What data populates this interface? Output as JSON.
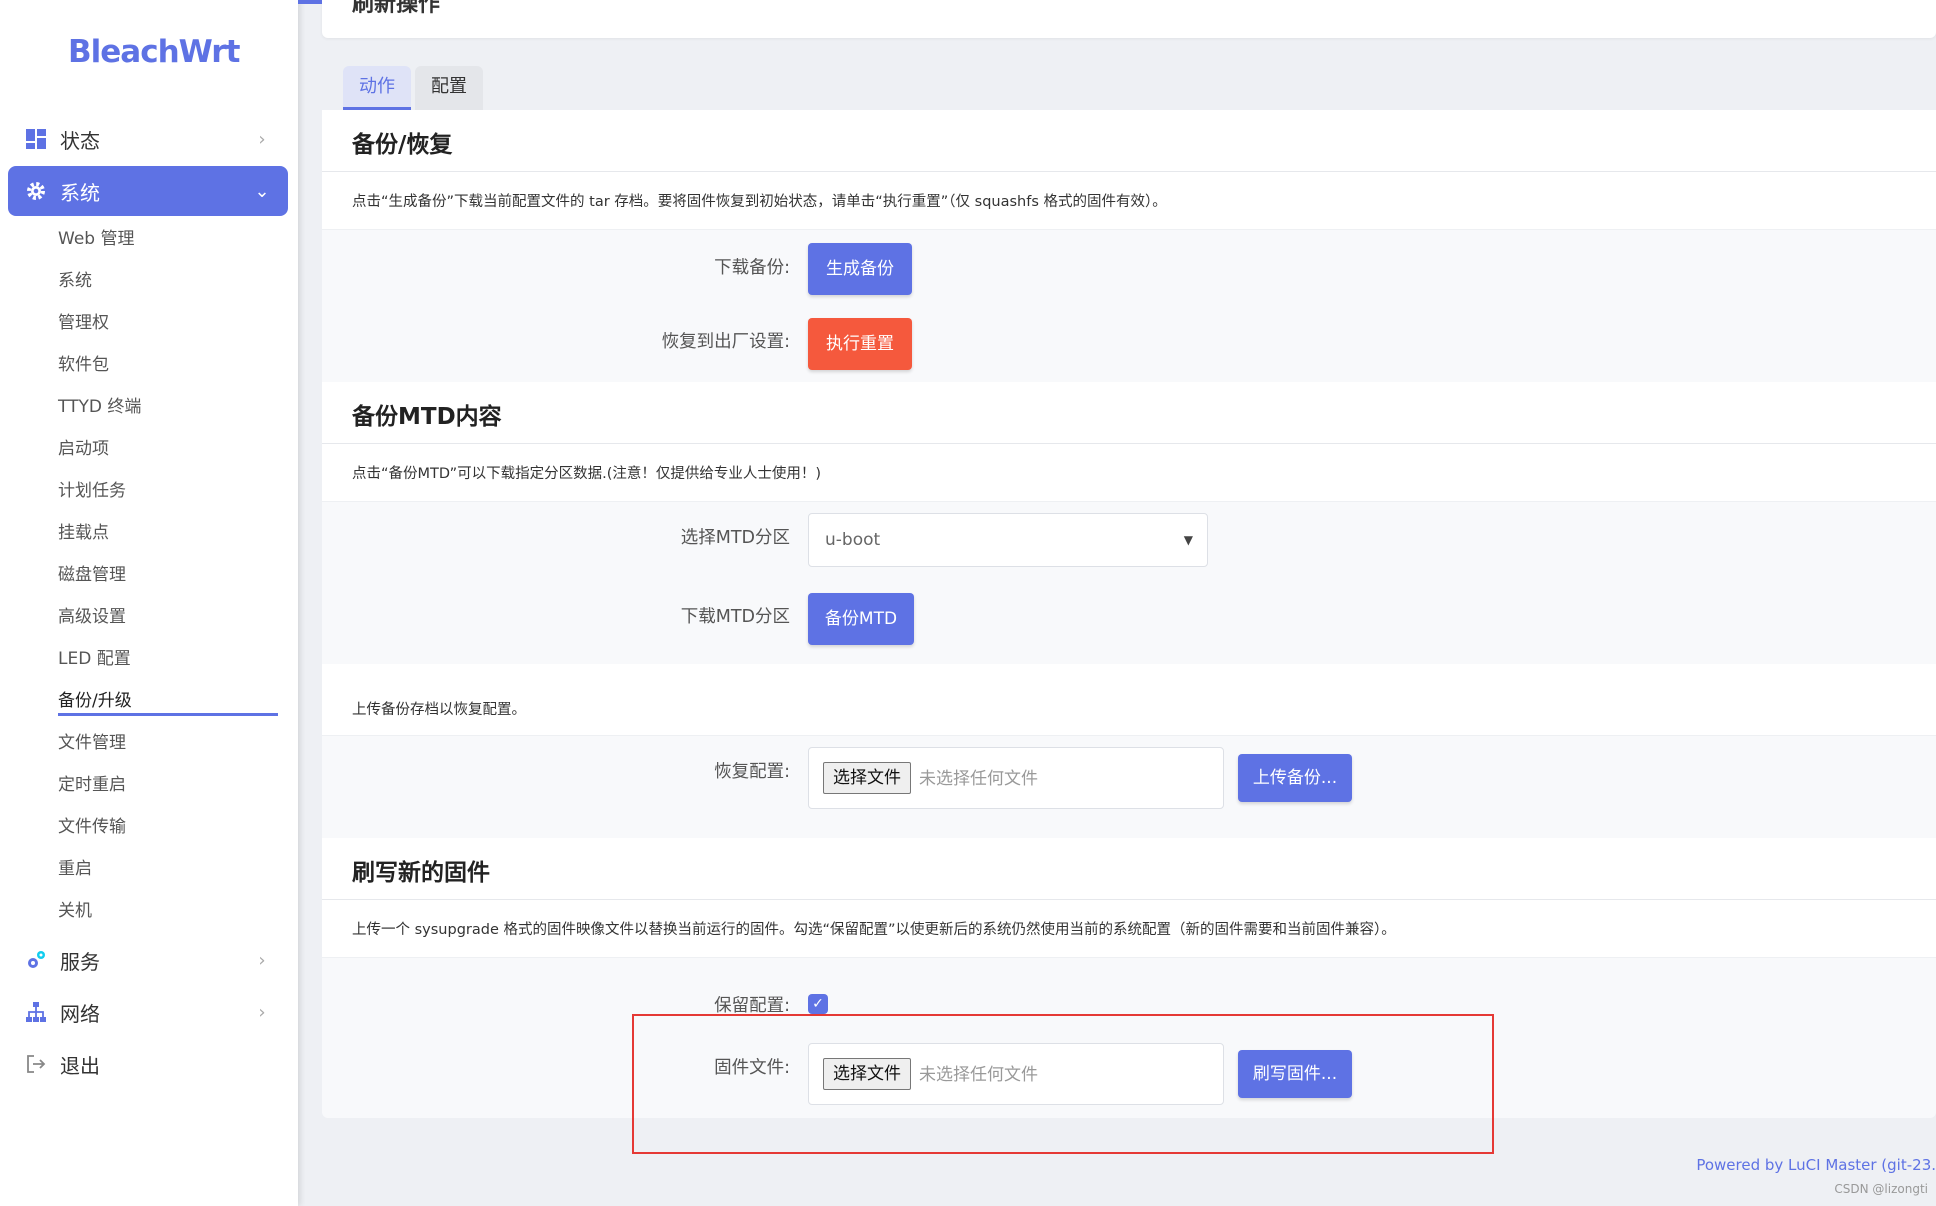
{
  "brand": "BleachWrt",
  "colors": {
    "accent": "#5e72e4",
    "danger": "#f5593d",
    "highlight_box": "#e53935"
  },
  "sidebar": {
    "status": {
      "label": "状态",
      "icon": "dashboard-icon"
    },
    "system": {
      "label": "系统",
      "icon": "gear-icon"
    },
    "system_items": [
      "Web 管理",
      "系统",
      "管理权",
      "软件包",
      "TTYD 终端",
      "启动项",
      "计划任务",
      "挂载点",
      "磁盘管理",
      "高级设置",
      "LED 配置",
      "备份/升级",
      "文件管理",
      "定时重启",
      "文件传输",
      "重启",
      "关机"
    ],
    "services": {
      "label": "服务",
      "icon": "services-gears-icon"
    },
    "network": {
      "label": "网络",
      "icon": "network-tree-icon"
    },
    "logout": {
      "label": "退出",
      "icon": "logout-icon"
    }
  },
  "page": {
    "title": "刷新操作"
  },
  "tabs": [
    "动作",
    "配置"
  ],
  "backup": {
    "title": "备份/恢复",
    "desc": "点击“生成备份”下载当前配置文件的 tar 存档。要将固件恢复到初始状态，请单击“执行重置”（仅 squashfs 格式的固件有效）。",
    "download_label": "下载备份:",
    "download_btn": "生成备份",
    "reset_label": "恢复到出厂设置:",
    "reset_btn": "执行重置"
  },
  "mtd": {
    "title": "备份MTD内容",
    "desc": "点击“备份MTD”可以下载指定分区数据.(注意！仅提供给专业人士使用！)",
    "select_label": "选择MTD分区",
    "select_value": "u-boot",
    "download_label": "下载MTD分区",
    "download_btn": "备份MTD"
  },
  "restore": {
    "desc": "上传备份存档以恢复配置。",
    "label": "恢复配置:",
    "choose_btn": "选择文件",
    "no_file": "未选择任何文件",
    "upload_btn": "上传备份..."
  },
  "flash": {
    "title": "刷写新的固件",
    "desc": "上传一个 sysupgrade 格式的固件映像文件以替换当前运行的固件。勾选“保留配置”以使更新后的系统仍然使用当前的系统配置（新的固件需要和当前固件兼容）。",
    "keep_label": "保留配置:",
    "keep_checked": true,
    "file_label": "固件文件:",
    "choose_btn": "选择文件",
    "no_file": "未选择任何文件",
    "flash_btn": "刷写固件..."
  },
  "footer": "Powered by LuCI Master (git-23.",
  "watermark": "CSDN @lizongti"
}
